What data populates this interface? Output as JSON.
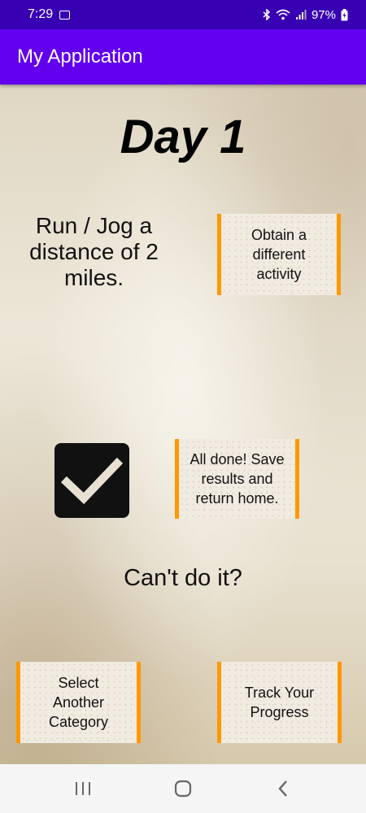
{
  "status_bar": {
    "time": "7:29",
    "battery": "97%"
  },
  "app_bar": {
    "title": "My Application"
  },
  "main": {
    "day_title": "Day 1",
    "activity": "Run / Jog a distance of 2 miles.",
    "obtain_button": "Obtain a different activity",
    "done_checked": true,
    "done_button": "All done! Save results and return home.",
    "cant_text": "Can't do it?",
    "select_button": "Select Another Category",
    "track_button": "Track Your Progress"
  },
  "colors": {
    "status_bar": "#3700b3",
    "app_bar": "#6200ee",
    "button_border": "#ff9800"
  },
  "nav": {
    "icons": [
      "recent-apps-icon",
      "home-icon",
      "back-icon"
    ]
  }
}
